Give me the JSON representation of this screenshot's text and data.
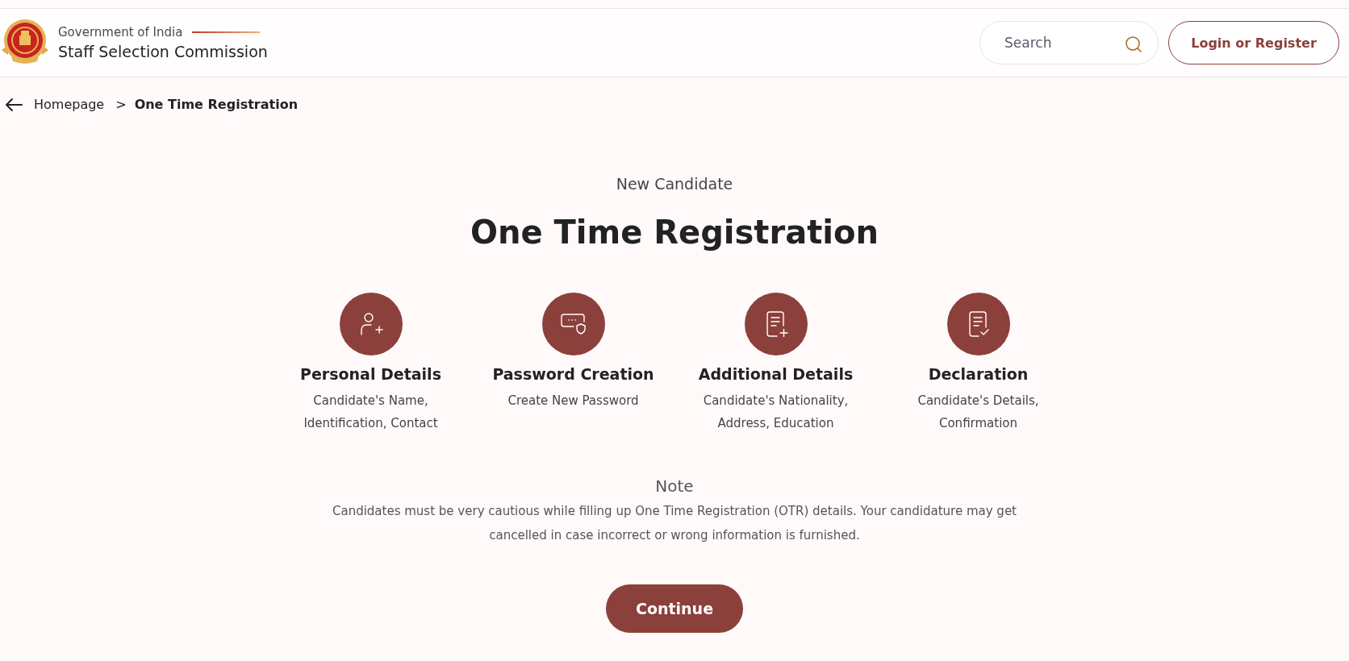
{
  "header": {
    "org_line": "Government of India",
    "org_name": "Staff Selection Commission",
    "search": {
      "placeholder": "Search"
    },
    "login_button": "Login or Register"
  },
  "breadcrumb": {
    "items": [
      "Homepage",
      "One Time Registration"
    ],
    "separator": ">"
  },
  "intro": {
    "subtitle": "New Candidate",
    "title": "One Time Registration"
  },
  "steps": [
    {
      "kind": "person",
      "title": "Personal Details",
      "description": "Candidate's Name, Identification, Contact"
    },
    {
      "kind": "password",
      "title": "Password Creation",
      "description": "Create New Password"
    },
    {
      "kind": "document-add",
      "title": "Additional Details",
      "description": "Candidate's Nationality, Address, Education"
    },
    {
      "kind": "document-check",
      "title": "Declaration",
      "description": "Candidate's Details, Confirmation"
    }
  ],
  "note": {
    "title": "Note",
    "text": "Candidates must be very cautious while filling up One Time Registration (OTR) details. Your candidature may get cancelled in case incorrect or wrong information is furnished."
  },
  "continue_button": "Continue"
}
